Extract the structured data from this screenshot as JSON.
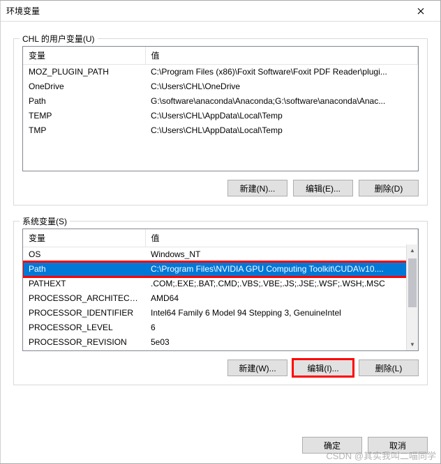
{
  "window": {
    "title": "环境变量",
    "close_label": "Close"
  },
  "user_group": {
    "label": "CHL 的用户变量(U)",
    "header_var": "变量",
    "header_val": "值",
    "rows": [
      {
        "var": "MOZ_PLUGIN_PATH",
        "val": "C:\\Program Files (x86)\\Foxit Software\\Foxit PDF Reader\\plugi..."
      },
      {
        "var": "OneDrive",
        "val": "C:\\Users\\CHL\\OneDrive"
      },
      {
        "var": "Path",
        "val": "G:\\software\\anaconda\\Anaconda;G:\\software\\anaconda\\Anac..."
      },
      {
        "var": "TEMP",
        "val": "C:\\Users\\CHL\\AppData\\Local\\Temp"
      },
      {
        "var": "TMP",
        "val": "C:\\Users\\CHL\\AppData\\Local\\Temp"
      }
    ],
    "buttons": {
      "new": "新建(N)...",
      "edit": "编辑(E)...",
      "delete": "删除(D)"
    }
  },
  "system_group": {
    "label": "系统变量(S)",
    "header_var": "变量",
    "header_val": "值",
    "rows": [
      {
        "var": "OS",
        "val": "Windows_NT"
      },
      {
        "var": "Path",
        "val": "C:\\Program Files\\NVIDIA GPU Computing Toolkit\\CUDA\\v10...."
      },
      {
        "var": "PATHEXT",
        "val": ".COM;.EXE;.BAT;.CMD;.VBS;.VBE;.JS;.JSE;.WSF;.WSH;.MSC"
      },
      {
        "var": "PROCESSOR_ARCHITECT...",
        "val": "AMD64"
      },
      {
        "var": "PROCESSOR_IDENTIFIER",
        "val": "Intel64 Family 6 Model 94 Stepping 3, GenuineIntel"
      },
      {
        "var": "PROCESSOR_LEVEL",
        "val": "6"
      },
      {
        "var": "PROCESSOR_REVISION",
        "val": "5e03"
      }
    ],
    "selected_index": 1,
    "buttons": {
      "new": "新建(W)...",
      "edit": "编辑(I)...",
      "delete": "删除(L)"
    }
  },
  "dialog_buttons": {
    "ok": "确定",
    "cancel": "取消"
  },
  "watermark": "CSDN @其实我叫二喵同学​"
}
